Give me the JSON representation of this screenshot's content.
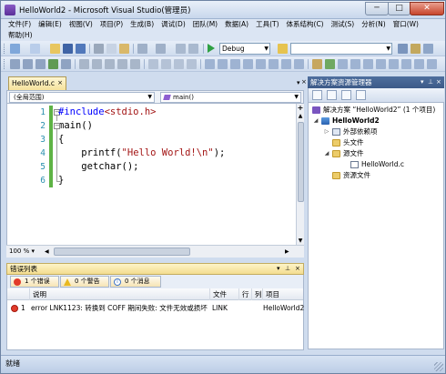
{
  "window": {
    "title": "HelloWorld2 - Microsoft Visual Studio(管理员)",
    "minimize": "─",
    "maximize": "□",
    "close": "✕"
  },
  "menu": {
    "row1": [
      "文件(F)",
      "编辑(E)",
      "视图(V)",
      "项目(P)",
      "生成(B)",
      "调试(D)",
      "团队(M)",
      "数据(A)",
      "工具(T)",
      "体系结构(C)",
      "测试(S)",
      "分析(N)",
      "窗口(W)"
    ],
    "row2": [
      "帮助(H)"
    ]
  },
  "toolbar": {
    "configuration": "Debug",
    "find_value": ""
  },
  "editor": {
    "tab_label": "HelloWorld.c",
    "tab_close": "×",
    "scope_dropdown": "(全局范围)",
    "function_dropdown": "main()",
    "zoom": "100 %",
    "lines": [
      {
        "num": "1",
        "pre": "#include",
        "str": "<stdio.h>",
        "post": ""
      },
      {
        "num": "2",
        "pre": "main()",
        "str": "",
        "post": ""
      },
      {
        "num": "3",
        "pre": "{",
        "str": "",
        "post": ""
      },
      {
        "num": "4",
        "pre": "    printf(",
        "str": "\"Hello World!\\n\"",
        "post": ");"
      },
      {
        "num": "5",
        "pre": "    getchar();",
        "str": "",
        "post": ""
      },
      {
        "num": "6",
        "pre": "}",
        "str": "",
        "post": ""
      }
    ]
  },
  "error_list": {
    "title": "错误列表",
    "filters": {
      "errors": "1 个错误",
      "warnings": "0 个警告",
      "messages": "0 个消息"
    },
    "columns": [
      "说明",
      "文件",
      "行",
      "列",
      "项目"
    ],
    "rows": [
      {
        "index": "1",
        "description": "error LNK1123: 转换到 COFF 期间失败: 文件无效或损坏",
        "file": "LINK",
        "line": "",
        "column": "",
        "project": "HelloWorld2"
      }
    ]
  },
  "solution_explorer": {
    "title": "解决方案资源管理器",
    "solution": "解决方案 “HelloWorld2” (1 个项目)",
    "project": "HelloWorld2",
    "items": {
      "external_deps": "外部依赖项",
      "header_files": "头文件",
      "source_files": "源文件",
      "source_file": "HelloWorld.c",
      "resource_files": "资源文件"
    }
  },
  "status": {
    "text": "就绪"
  },
  "colors": {
    "accent": "#3c5a88",
    "tab_active": "#f5e29c",
    "error_red": "#e23b2a",
    "keyword": "#0000ff",
    "string": "#a31515",
    "line_number": "#2b91af",
    "change_bar": "#5eb345"
  },
  "icons": {
    "app": "visual-studio-icon",
    "new_project": "new-project-icon",
    "open": "open-folder-icon",
    "save": "save-icon",
    "save_all": "save-all-icon",
    "cut": "cut-icon",
    "copy": "copy-icon",
    "paste": "paste-icon",
    "undo": "undo-icon",
    "redo": "redo-icon",
    "start": "start-debugging-icon",
    "find": "find-icon"
  }
}
